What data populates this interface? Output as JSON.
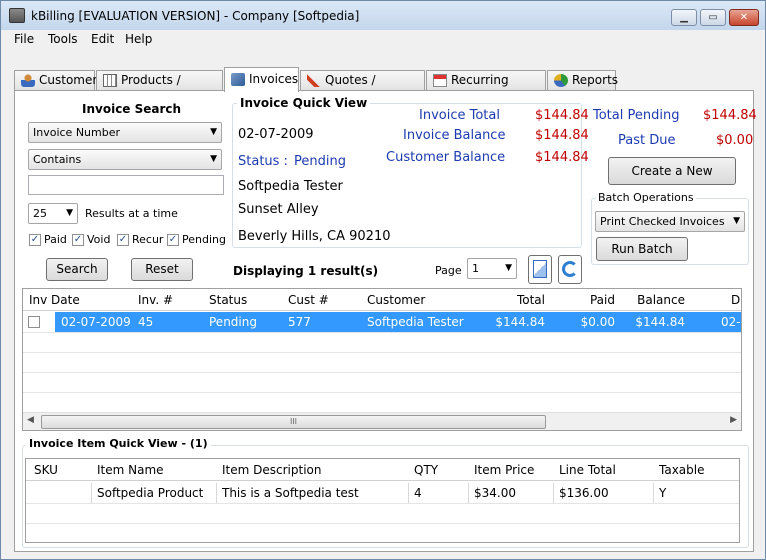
{
  "window": {
    "title": "kBilling [EVALUATION VERSION] - Company [Softpedia]",
    "controls": [
      "minimize",
      "maximize",
      "close"
    ]
  },
  "menu": [
    "File",
    "Tools",
    "Edit",
    "Help"
  ],
  "tabs": [
    {
      "label": "Customers",
      "icon": "people-icon"
    },
    {
      "label": "Products / Services",
      "icon": "grid-icon"
    },
    {
      "label": "Invoices",
      "icon": "invoice-icon",
      "active": true
    },
    {
      "label": "Quotes / Proposals",
      "icon": "pencil-icon"
    },
    {
      "label": "Recurring Invoices",
      "icon": "calendar-icon"
    },
    {
      "label": "Reports",
      "icon": "pie-chart-icon"
    }
  ],
  "search": {
    "title": "Invoice Search",
    "field_select": "Invoice Number",
    "mode_select": "Contains",
    "query": "",
    "results_select": "25",
    "results_label": "Results at a time",
    "filters": [
      {
        "label": "Paid",
        "checked": true
      },
      {
        "label": "Void",
        "checked": true
      },
      {
        "label": "Recur",
        "checked": true
      },
      {
        "label": "Pending",
        "checked": true
      }
    ],
    "search_button": "Search",
    "reset_button": "Reset"
  },
  "quick_view": {
    "title": "Invoice Quick View",
    "date": "02-07-2009",
    "status_label": "Status :",
    "status_value": "Pending",
    "customer_name": "Softpedia Tester",
    "address1": "Sunset Alley",
    "address2": "Beverly Hills, CA 90210",
    "invoice_total_label": "Invoice Total",
    "invoice_total": "$144.84",
    "invoice_balance_label": "Invoice Balance",
    "invoice_balance": "$144.84",
    "customer_balance_label": "Customer Balance",
    "customer_balance": "$144.84"
  },
  "summary": {
    "total_pending_label": "Total Pending",
    "total_pending": "$144.84",
    "past_due_label": "Past Due",
    "past_due": "$0.00",
    "create_button": "Create a New Invoice",
    "batch_title": "Batch Operations",
    "batch_select": "Print Checked Invoices",
    "run_batch_button": "Run Batch"
  },
  "results": {
    "displaying": "Displaying 1 result(s)",
    "page_label": "Page",
    "page_value": "1"
  },
  "invoice_table": {
    "columns": [
      "Inv Date",
      "Inv. #",
      "Status",
      "Cust #",
      "Customer",
      "Total",
      "Paid",
      "Balance",
      "D"
    ],
    "rows": [
      [
        "02-07-2009",
        "45",
        "Pending",
        "577",
        "Softpedia Tester",
        "$144.84",
        "$0.00",
        "$144.84",
        "02-0"
      ]
    ],
    "scroll_grip": "III"
  },
  "item_view": {
    "title": "Invoice Item Quick View - (1)",
    "columns": [
      "SKU",
      "Item Name",
      "Item Description",
      "QTY",
      "Item Price",
      "Line Total",
      "Taxable"
    ],
    "rows": [
      [
        "",
        "Softpedia Product",
        "This is a Softpedia test",
        "4",
        "$34.00",
        "$136.00",
        "Y"
      ]
    ]
  },
  "colors": {
    "selection": "#3399ff",
    "accent_blue": "#1c3bb0",
    "money_red": "#c00000"
  }
}
